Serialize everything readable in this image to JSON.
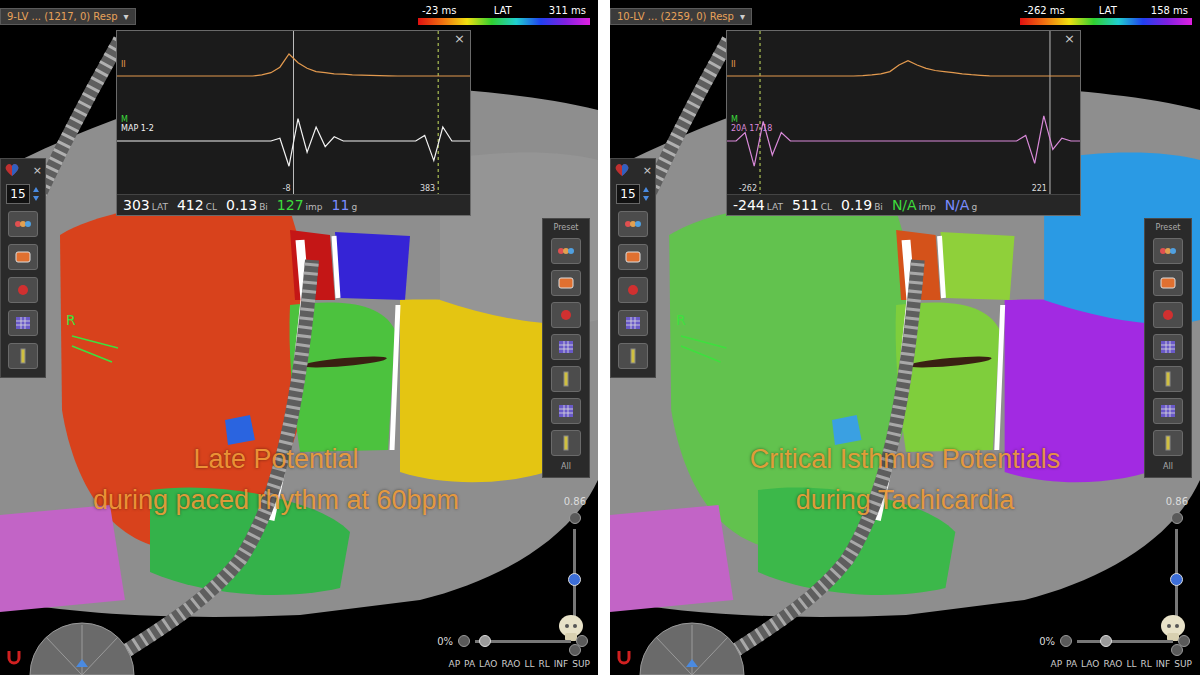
{
  "panels": [
    {
      "selector": {
        "label": "9-LV ... (1217, 0) Resp",
        "arrow": "▾"
      },
      "scale": {
        "min": "-23 ms",
        "title": "LAT",
        "max": "311 ms"
      },
      "signal": {
        "close": "×",
        "range_ms": [
          -485,
          469
        ],
        "traces": [
          {
            "mark": "",
            "name": "II",
            "color": "#e39a4f",
            "samples": [
              0,
              0,
              0,
              0,
              0,
              0,
              0,
              0,
              0,
              0,
              0,
              0,
              0,
              0,
              0,
              0,
              0.05,
              0.15,
              0.4,
              1,
              0.6,
              0.35,
              0.2,
              0.15,
              0.1,
              0.08,
              0.05,
              0.04,
              0.03,
              0.02,
              0.01,
              0,
              0,
              0,
              0,
              0,
              0,
              0,
              0,
              0
            ]
          },
          {
            "mark": "M",
            "name": "MAP 1-2",
            "color": "#f2f2f2",
            "samples": [
              0,
              0,
              0,
              0,
              0,
              0,
              0,
              0,
              0,
              0,
              0,
              0,
              0,
              0,
              0,
              0,
              0,
              0,
              0.1,
              -0.9,
              0.8,
              -0.4,
              0.5,
              -0.2,
              0.15,
              0,
              0,
              0,
              0,
              0,
              0,
              0,
              0,
              0,
              0.2,
              -0.7,
              0.5,
              0,
              0,
              0
            ]
          }
        ],
        "markers": [
          {
            "label": "-8",
            "ms": -8,
            "kind": "solid"
          },
          {
            "label": "383",
            "ms": 383,
            "kind": "dashed"
          }
        ],
        "readouts": [
          {
            "value": "303",
            "unit": "LAT",
            "color": "#ffffff"
          },
          {
            "value": "412",
            "unit": "CL",
            "color": "#ffffff"
          },
          {
            "value": "0.13",
            "unit": "Bi",
            "color": "#ffffff"
          },
          {
            "value": "127",
            "unit": "imp",
            "color": "#3ddc3d"
          },
          {
            "value": "11",
            "unit": "g",
            "color": "#7b8cff"
          }
        ]
      },
      "toolbar": {
        "close": "×",
        "count": "15"
      },
      "tools": {
        "preset": "Preset",
        "filter": "All"
      },
      "orientation": "R",
      "map": {
        "regions": [
          {
            "color": "#d8421c"
          },
          {
            "color": "#c41616"
          },
          {
            "color": "#3524d6"
          },
          {
            "color": "#4cc23e"
          },
          {
            "color": "#e4c512"
          },
          {
            "color": "#c264c6"
          },
          {
            "color": "#34b24a"
          },
          {
            "color": "#959595"
          },
          {
            "color": "#2a64e0"
          }
        ]
      },
      "caption": [
        "Late Potential",
        "during paced rhythm at 60bpm"
      ],
      "zoom": {
        "reading": "0%",
        "level": 0.1
      },
      "opacity": {
        "reading": "0.86",
        "level": 0.55
      },
      "views": [
        "AP",
        "PA",
        "LAO",
        "RAO",
        "LL",
        "RL",
        "INF",
        "SUP"
      ]
    },
    {
      "selector": {
        "label": "10-LV ... (2259, 0) Resp",
        "arrow": "▾"
      },
      "scale": {
        "min": "-262 ms",
        "title": "LAT",
        "max": "158 ms"
      },
      "signal": {
        "close": "×",
        "range_ms": [
          -317,
          271
        ],
        "traces": [
          {
            "mark": "",
            "name": "II",
            "color": "#e39a4f",
            "samples": [
              0,
              0,
              0,
              0,
              0,
              0,
              0,
              0,
              0,
              0,
              0,
              0,
              0,
              0,
              0,
              0.02,
              0.05,
              0.1,
              0.2,
              0.5,
              0.7,
              0.5,
              0.35,
              0.25,
              0.2,
              0.15,
              0.1,
              0.06,
              0.03,
              0.01,
              0,
              0,
              0,
              0,
              0,
              0,
              0,
              0,
              0,
              0
            ]
          },
          {
            "mark": "M",
            "name": "20A 17-18",
            "color": "#d98ad9",
            "samples": [
              0,
              0,
              0.3,
              -0.9,
              0.7,
              -0.5,
              0.3,
              0,
              0,
              0,
              0,
              0,
              0,
              0,
              0,
              0,
              0,
              0,
              0,
              0,
              0,
              0,
              0,
              0,
              0,
              0,
              0,
              0,
              0,
              0,
              0,
              0,
              0,
              0.2,
              -0.8,
              0.9,
              -0.3,
              0.1,
              0,
              0
            ]
          }
        ],
        "markers": [
          {
            "label": "-262",
            "ms": -262,
            "kind": "dashed"
          },
          {
            "label": "221",
            "ms": 221,
            "kind": "solid"
          }
        ],
        "readouts": [
          {
            "value": "-244",
            "unit": "LAT",
            "color": "#ffffff"
          },
          {
            "value": "511",
            "unit": "CL",
            "color": "#ffffff"
          },
          {
            "value": "0.19",
            "unit": "Bi",
            "color": "#ffffff"
          },
          {
            "value": "N/A",
            "unit": "imp",
            "color": "#3ddc3d"
          },
          {
            "value": "N/A",
            "unit": "g",
            "color": "#7b8cff"
          }
        ]
      },
      "toolbar": {
        "close": "×",
        "count": "15"
      },
      "tools": {
        "preset": "Preset",
        "filter": "All"
      },
      "orientation": "R",
      "map": {
        "regions": [
          {
            "color": "#62c24e"
          },
          {
            "color": "#d4521a"
          },
          {
            "color": "#8fd03a"
          },
          {
            "color": "#7fce3c"
          },
          {
            "color": "#a22ae2"
          },
          {
            "color": "#c264c6"
          },
          {
            "color": "#3cb84a"
          },
          {
            "color": "#2a9ae4"
          },
          {
            "color": "#3aa0e2"
          }
        ]
      },
      "caption": [
        "Critical Isthmus Potentials",
        "during Tachicardia"
      ],
      "zoom": {
        "reading": "0%",
        "level": 0.3
      },
      "opacity": {
        "reading": "0.86",
        "level": 0.55
      },
      "views": [
        "AP",
        "PA",
        "LAO",
        "RAO",
        "LL",
        "RL",
        "INF",
        "SUP"
      ]
    }
  ]
}
